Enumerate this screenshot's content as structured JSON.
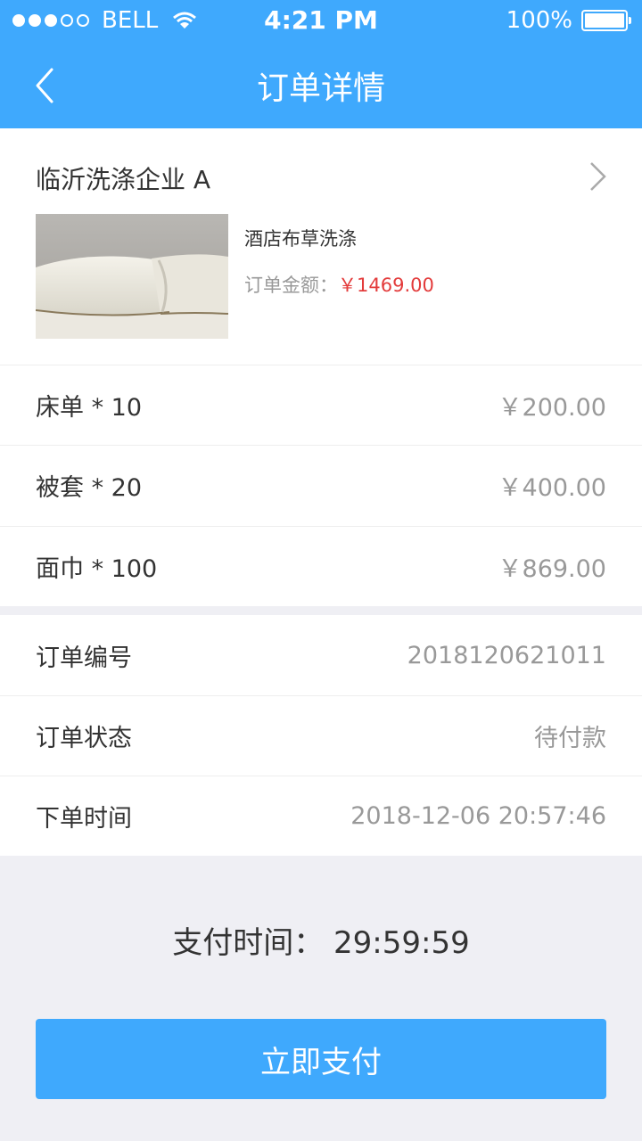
{
  "status_bar": {
    "carrier": "BELL",
    "time": "4:21 PM",
    "battery": "100%",
    "signal_icon": "signal-dots-icon",
    "wifi_icon": "wifi-icon"
  },
  "nav": {
    "title": "订单详情",
    "back_icon": "chevron-left-icon"
  },
  "order": {
    "company": "临沂洗涤企业 A",
    "service_name": "酒店布草洗涤",
    "amount_label": "订单金额：",
    "amount_value": "￥1469.00",
    "image": "pillow-photo"
  },
  "items": [
    {
      "name": "床单 * 10",
      "price": "￥200.00"
    },
    {
      "name": "被套 * 20",
      "price": "￥400.00"
    },
    {
      "name": "面巾 * 100",
      "price": "￥869.00"
    }
  ],
  "info": {
    "order_no_label": "订单编号",
    "order_no": "2018120621011",
    "status_label": "订单状态",
    "status": "待付款",
    "time_label": "下单时间",
    "time": "2018-12-06 20:57:46"
  },
  "countdown": "支付时间：  29:59:59",
  "pay_button": "立即支付",
  "colors": {
    "accent": "#3fa9fd",
    "price_red": "#e33b3b"
  }
}
